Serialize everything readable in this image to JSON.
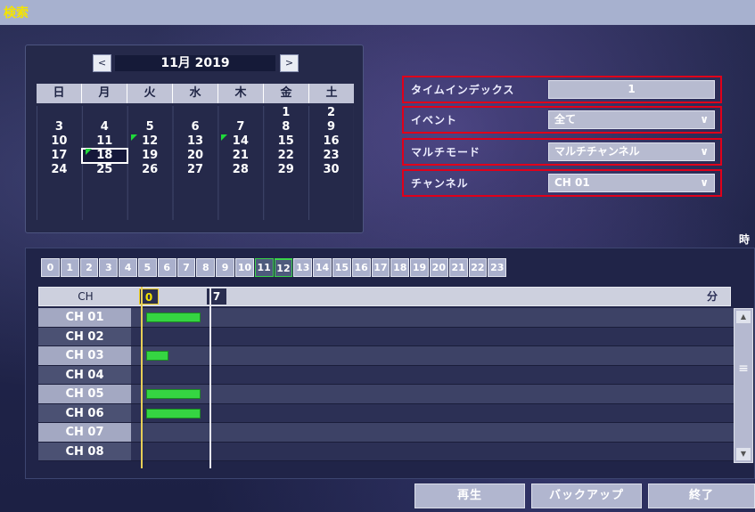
{
  "window": {
    "title": "検索"
  },
  "calendar": {
    "prev_label": "<",
    "next_label": ">",
    "month_label": "11月 2019",
    "weekdays": [
      "日",
      "月",
      "火",
      "水",
      "木",
      "金",
      "土"
    ],
    "days": [
      "",
      "",
      "",
      "",
      "",
      "1",
      "2",
      "3",
      "4",
      "5",
      "6",
      "7",
      "8",
      "9",
      "10",
      "11",
      "12",
      "13",
      "14",
      "15",
      "16",
      "17",
      "18",
      "19",
      "20",
      "21",
      "22",
      "23",
      "24",
      "25",
      "26",
      "27",
      "28",
      "29",
      "30",
      "",
      "",
      "",
      "",
      "",
      ""
    ],
    "selected_day": "18",
    "recorded_days": [
      "12",
      "14",
      "18"
    ]
  },
  "fields": {
    "time_index": {
      "label": "タイムインデックス",
      "value": "1"
    },
    "event": {
      "label": "イベント",
      "value": "全て"
    },
    "multi_mode": {
      "label": "マルチモード",
      "value": "マルチチャンネル"
    },
    "channel": {
      "label": "チャンネル",
      "value": "CH 01"
    }
  },
  "timeline": {
    "hour_unit_label": "時",
    "minute_unit_label": "分",
    "hours": [
      "0",
      "1",
      "2",
      "3",
      "4",
      "5",
      "6",
      "7",
      "8",
      "9",
      "10",
      "11",
      "12",
      "13",
      "14",
      "15",
      "16",
      "17",
      "18",
      "19",
      "20",
      "21",
      "22",
      "23"
    ],
    "active_hours": [
      "11",
      "12"
    ],
    "current_hour": "12",
    "channel_header": "CH",
    "cursor_start_label": "0",
    "cursor_end_label": "7",
    "channels": [
      "CH 01",
      "CH 02",
      "CH 03",
      "CH 04",
      "CH 05",
      "CH 06",
      "CH 07",
      "CH 08"
    ],
    "recordings_minutes": [
      [
        1,
        6
      ],
      null,
      [
        1,
        3
      ],
      null,
      [
        1,
        6
      ],
      [
        1,
        6
      ],
      null,
      null
    ]
  },
  "buttons": {
    "play": "再生",
    "backup": "バックアップ",
    "exit": "終了"
  },
  "colors": {
    "record_bar": "#35d542",
    "highlight_box": "#e0001a",
    "title_text": "#f4e400"
  }
}
